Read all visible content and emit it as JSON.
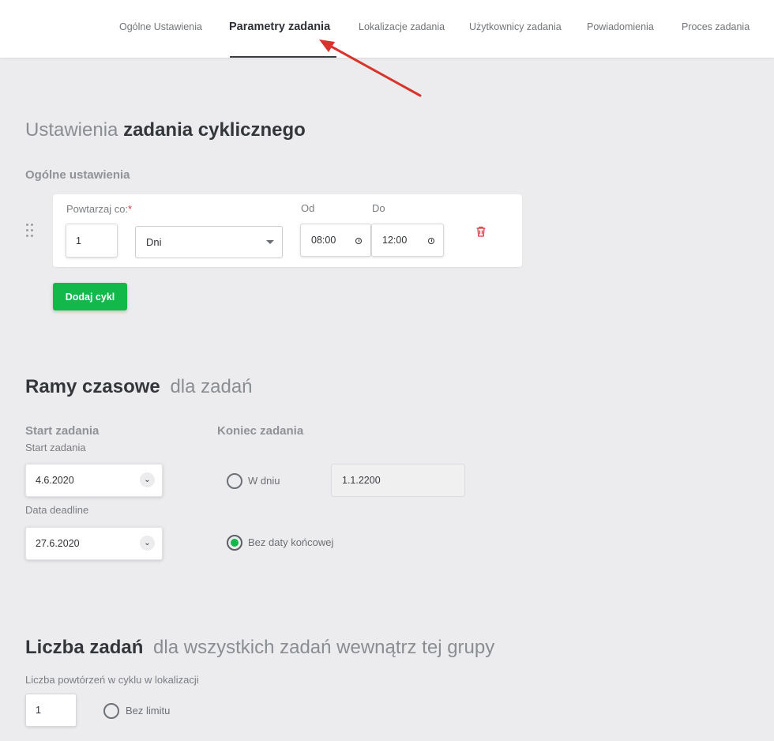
{
  "tabs": [
    {
      "label": "Ogólne Ustawienia",
      "active": false
    },
    {
      "label": "Parametry zadania",
      "active": true
    },
    {
      "label": "Lokalizacje zadania",
      "active": false
    },
    {
      "label": "Użytkownicy zadania",
      "active": false
    },
    {
      "label": "Powiadomienia",
      "active": false
    },
    {
      "label": "Proces zadania",
      "active": false
    }
  ],
  "cyclic": {
    "heading_light": "Ustawienia",
    "heading_bold": "zadania cyklicznego",
    "general_label": "Ogólne ustawienia",
    "repeat_label": "Powtarzaj co:",
    "required_mark": "*",
    "repeat_value": "1",
    "unit_value": "Dni",
    "from_label": "Od",
    "from_value": "08:00",
    "to_label": "Do",
    "to_value": "12:00",
    "add_cycle_label": "Dodaj cykl"
  },
  "timeframe": {
    "heading_bold": "Ramy czasowe",
    "heading_light": "dla zadań",
    "start_heading": "Start zadania",
    "start_label": "Start zadania",
    "start_value": "4.6.2020",
    "deadline_label": "Data deadline",
    "deadline_value": "27.6.2020",
    "end_heading": "Koniec zadania",
    "on_day_label": "W dniu",
    "on_day_value": "1.1.2200",
    "no_end_label": "Bez daty końcowej",
    "selected": "no_end"
  },
  "count": {
    "heading_bold": "Liczba zadań",
    "heading_light": "dla wszystkich zadań wewnątrz tej grupy",
    "repeats_label": "Liczba powtórzeń w cyklu w lokalizacji",
    "repeats_value": "1",
    "no_limit_label": "Bez limitu"
  },
  "colors": {
    "accent": "#13b84a",
    "arrow": "#d9342b",
    "danger": "#d23b3b"
  }
}
